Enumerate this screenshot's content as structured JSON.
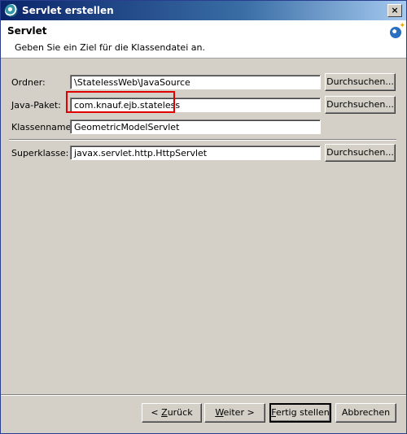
{
  "window": {
    "title": "Servlet erstellen",
    "close_symbol": "×"
  },
  "header": {
    "title": "Servlet",
    "description": "Geben Sie ein Ziel für die Klassendatei an."
  },
  "form": {
    "folder": {
      "label": "Ordner:",
      "value": "\\StatelessWeb\\JavaSource",
      "browse_label": "Durchsuchen..."
    },
    "package": {
      "label": "Java-Paket:",
      "value": "com.knauf.ejb.stateless",
      "browse_label": "Durchsuchen..."
    },
    "classname": {
      "label": "Klassenname:",
      "value": "GeometricModelServlet"
    },
    "superclass": {
      "label": "Superklasse:",
      "value": "javax.servlet.http.HttpServlet",
      "browse_label": "Durchsuchen..."
    }
  },
  "buttons": {
    "back_prefix": "< ",
    "back_mnemonic": "Z",
    "back_rest": "urück",
    "next_mnemonic": "W",
    "next_rest": "eiter >",
    "finish_mnemonic": "F",
    "finish_rest": "ertig stellen",
    "cancel": "Abbrechen"
  },
  "colors": {
    "title_gradient_start": "#0a246a",
    "highlight": "#e00000",
    "face": "#d4d0c8"
  }
}
